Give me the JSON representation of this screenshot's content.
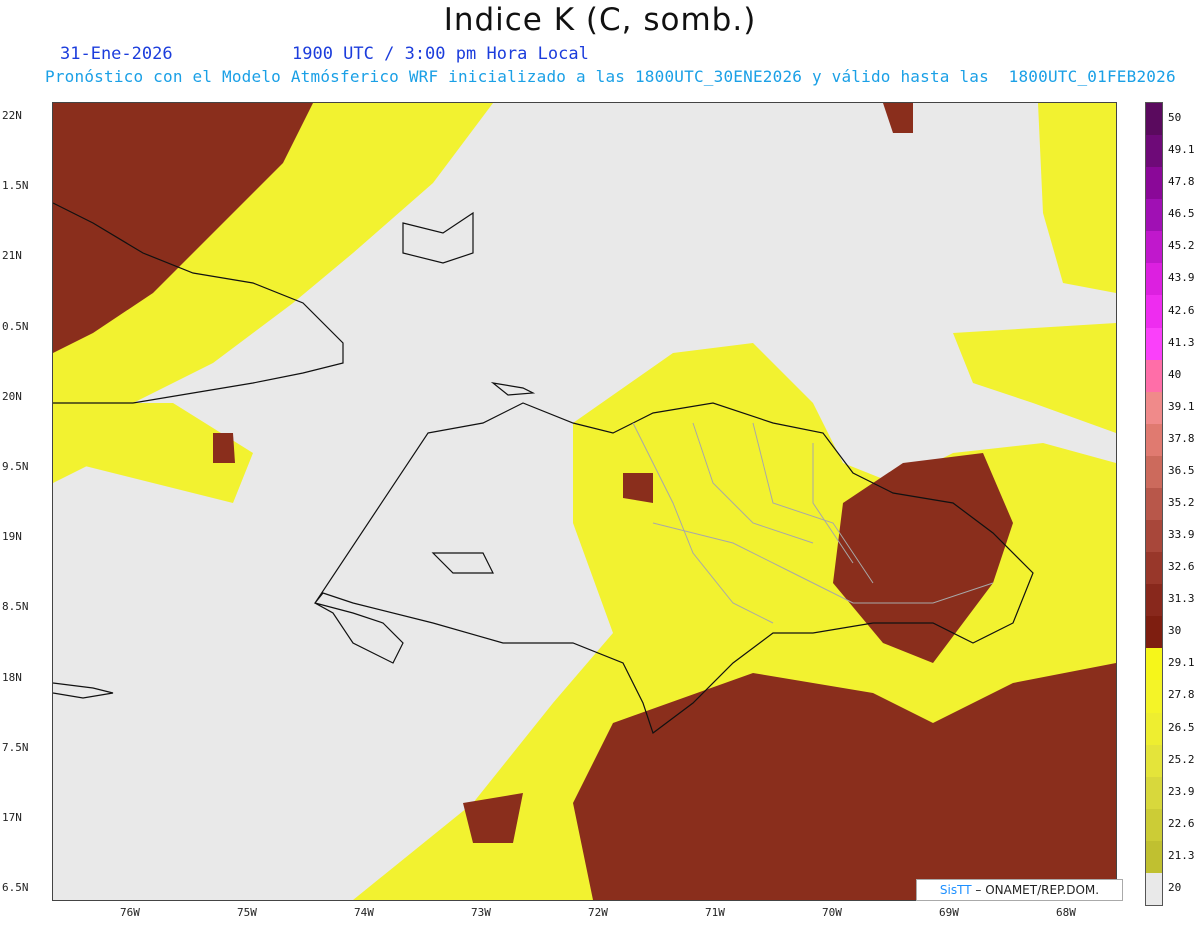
{
  "title": "Indice K (C, somb.)",
  "date": "31-Ene-2026",
  "time": "1900 UTC / 3:00 pm Hora Local",
  "subtitle": "Pronóstico con el Modelo Atmósferico WRF inicializado a las 1800UTC_30ENE2026 y válido hasta las  1800UTC_01FEB2026",
  "credit": {
    "brand": "SisTT",
    "text": "– ONAMET/REP.DOM."
  },
  "lat_ticks": [
    "22N",
    "1.5N",
    "21N",
    "0.5N",
    "20N",
    "9.5N",
    "19N",
    "8.5N",
    "18N",
    "7.5N",
    "17N",
    "6.5N"
  ],
  "lon_ticks": [
    "76W",
    "75W",
    "74W",
    "73W",
    "72W",
    "71W",
    "70W",
    "69W",
    "68W"
  ],
  "colorbar": {
    "labels": [
      "50",
      "49.1",
      "47.8",
      "46.5",
      "45.2",
      "43.9",
      "42.6",
      "41.3",
      "40",
      "39.1",
      "37.8",
      "36.5",
      "35.2",
      "33.9",
      "32.6",
      "31.3",
      "30",
      "29.1",
      "27.8",
      "26.5",
      "25.2",
      "23.9",
      "22.6",
      "21.3",
      "20"
    ],
    "colors": [
      "#5a0a5e",
      "#6e0a78",
      "#8a0898",
      "#a010b4",
      "#c018cc",
      "#dc20e0",
      "#ee2cf0",
      "#fa40fa",
      "#ff6ea8",
      "#f08a8a",
      "#e07a70",
      "#cc6a5c",
      "#b8574a",
      "#a8473a",
      "#98372a",
      "#88281c",
      "#7e1e10",
      "#f6f61a",
      "#f4f428",
      "#eeee30",
      "#e4e43a",
      "#d8d83c",
      "#cccc36",
      "#c0c030",
      "#e9e9e9"
    ]
  },
  "colors": {
    "background": "#e9e9e9",
    "yellow": "#f2f230",
    "brown": "#8a2e1c",
    "coast": "#111111",
    "province": "#a8a8a8"
  }
}
